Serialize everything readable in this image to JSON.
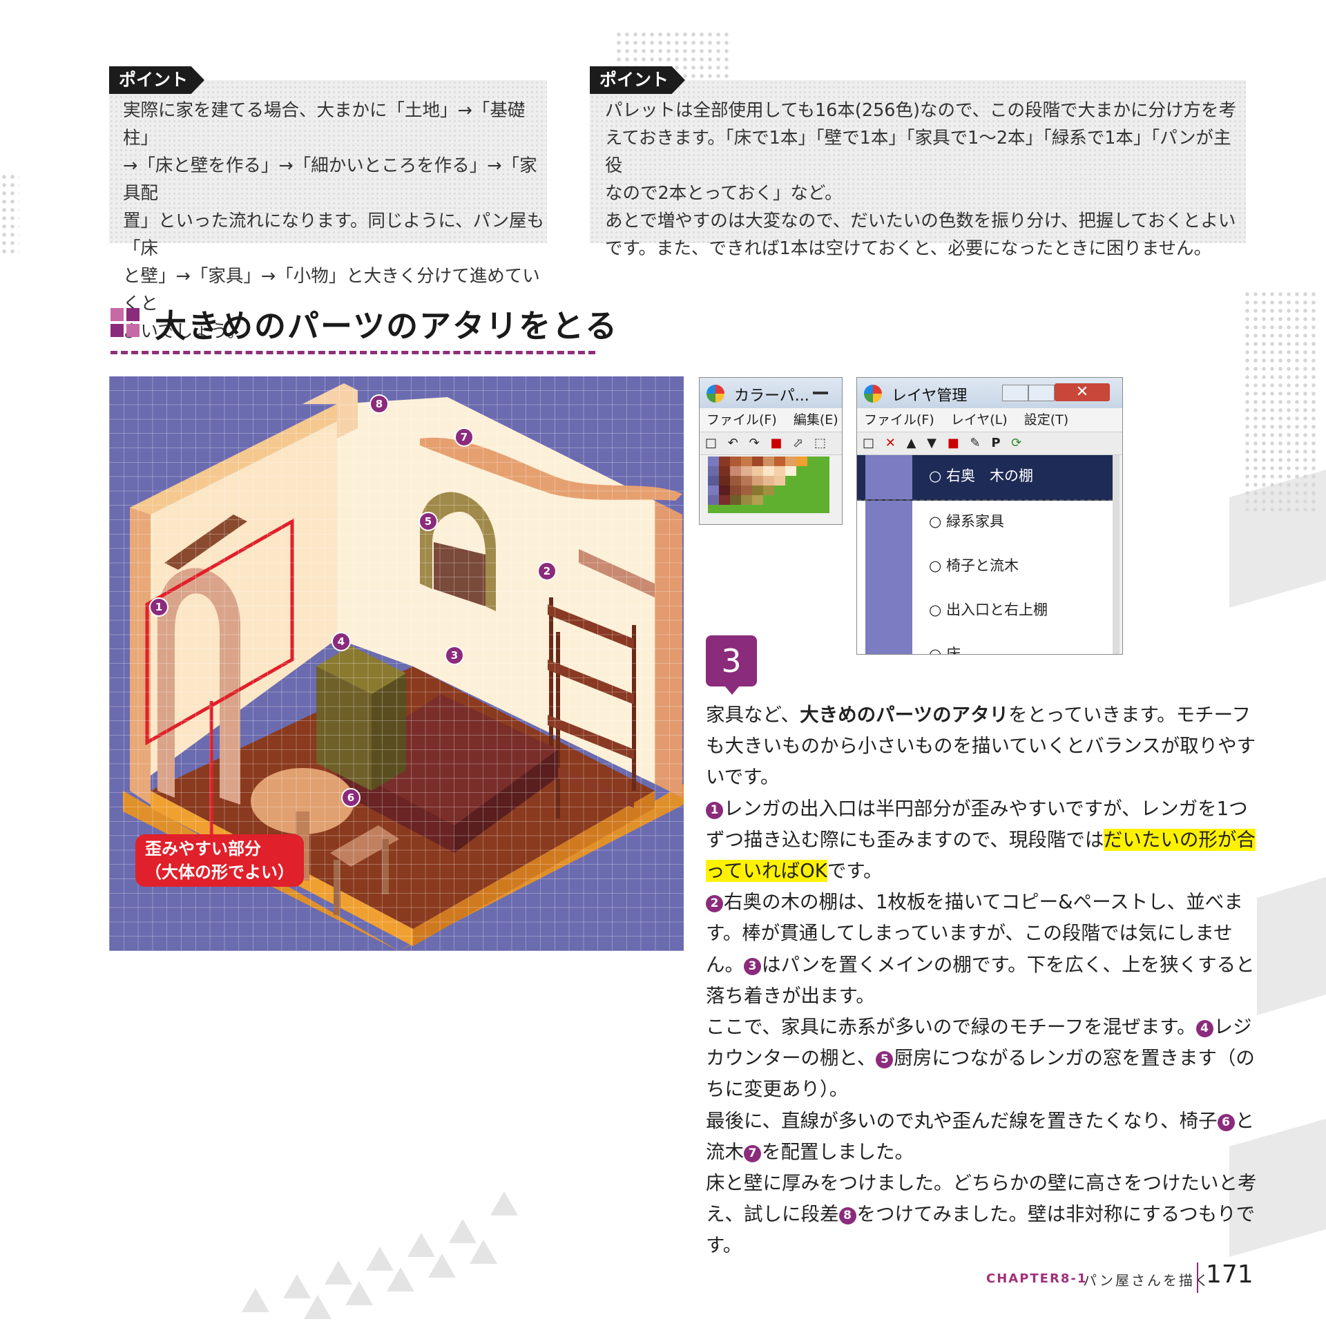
{
  "point_boxes": [
    {
      "tag": "ポイント",
      "lines": [
        "実際に家を建てる場合、大まかに「土地」→「基礎柱」",
        "→「床と壁を作る」→「細かいところを作る」→「家具配",
        "置」といった流れになります。同じように、パン屋も「床",
        "と壁」→「家具」→「小物」と大きく分けて進めていくと",
        "よいでしょう。"
      ]
    },
    {
      "tag": "ポイント",
      "lines": [
        "パレットは全部使用しても16本(256色)なので、この段階で大まかに分け方を考",
        "えておきます。「床で1本」「壁で1本」「家具で1〜2本」「緑系で1本」「パンが主役",
        "なので2本とっておく」など。",
        "あとで増やすのは大変なので、だいたいの色数を振り分け、把握しておくとよい",
        "です。また、できれば1本は空けておくと、必要になったときに困りません。"
      ]
    }
  ],
  "section_title": "大きめのパーツのアタリをとる",
  "figure": {
    "markers": [
      "8",
      "7",
      "5",
      "2",
      "1",
      "4",
      "3",
      "6"
    ],
    "callout_lines": [
      "歪みやすい部分",
      "（大体の形でよい）"
    ]
  },
  "palette_window": {
    "title": "カラーパ...",
    "menu": [
      "ファイル(F)",
      "編集(E)"
    ]
  },
  "layer_window": {
    "title": "レイヤ管理",
    "menu": [
      "ファイル(F)",
      "レイヤ(L)",
      "設定(T)"
    ],
    "layers": [
      "○ 右奥　木の棚",
      "○ 緑系家具",
      "○ 椅子と流木",
      "○ 出入口と右上棚",
      "○ 床"
    ]
  },
  "step_number": "3",
  "body": {
    "p1_a": "家具など、",
    "p1_bold": "大きめのパーツのアタリ",
    "p1_b": "をとっていきます。モチーフも大きいものから小さいものを描いていくとバランスが取りやすいです。",
    "p2_a": "レンガの出入口は半円部分が歪みやすいですが、レンガを1つずつ描き込む際にも歪みますので、現段階では",
    "p2_hl": "だいたいの形が合っていればOK",
    "p2_b": "です。",
    "p3_a": "右奥の木の棚は、1枚板を描いてコピー&ペーストし、並べます。棒が貫通してしまっていますが、この段階では気にしません。",
    "p3_b": "はパンを置くメインの棚です。下を広く、上を狭くすると落ち着きが出ます。",
    "p4_a": "ここで、家具に赤系が多いので緑のモチーフを混ぜます。",
    "p4_b": "レジカウンターの棚と、",
    "p4_c": "厨房につながるレンガの窓を置きます（のちに変更あり）。",
    "p5_a": "最後に、直線が多いので丸や歪んだ線を置きたくなり、椅子",
    "p5_b": "と流木",
    "p5_c": "を配置しました。",
    "p6_a": "床と壁に厚みをつけました。どちらかの壁に高さをつけたいと考え、試しに段差",
    "p6_b": "をつけてみました。壁は非対称にするつもりです。",
    "n1": "1",
    "n2": "2",
    "n3": "3",
    "n4": "4",
    "n5": "5",
    "n6": "6",
    "n7": "7",
    "n8": "8"
  },
  "footer": {
    "chapter": "CHAPTER8-1",
    "title": "パン屋さんを描く",
    "page": "171"
  },
  "colors": {
    "accent": "#8b2b7c",
    "highlight": "#fff200",
    "callout": "#e0202a",
    "canvas_bg": "#6b6bb0"
  }
}
